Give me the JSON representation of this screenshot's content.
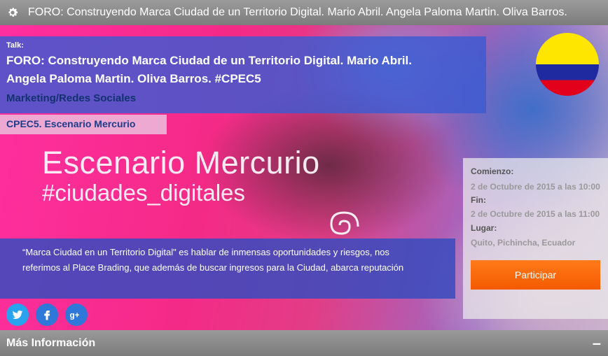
{
  "header": {
    "title": "FORO: Construyendo Marca Ciudad de un Territorio Digital. Mario Abril. Angela Paloma Martin. Oliva Barros.",
    "icon": "gear-icon"
  },
  "talk": {
    "kicker": "Talk:",
    "title": "FORO: Construyendo Marca Ciudad de un Territorio Digital. Mario Abril. Angela Paloma Martin. Oliva Barros. #CPEC5",
    "category": "Marketing/Redes Sociales"
  },
  "stage": {
    "tag": "CPEC5. Escenario Mercurio",
    "banner_title": "Escenario Mercurio",
    "banner_hashtag": "#ciudades_digitales"
  },
  "schedule": {
    "start_label": "Comienzo:",
    "start_value": "2 de Octubre de 2015 a las 10:00",
    "end_label": "Fin:",
    "end_value": "2 de Octubre de 2015 a las 11:00",
    "place_label": "Lugar:",
    "place_value": "Quito, Pichincha, Ecuador",
    "cta": "Participar"
  },
  "description": "“Marca Ciudad en un Territorio Digital\" es hablar de inmensas oportunidades y riesgos, nos referimos al Place Brading, que además de buscar ingresos para la Ciudad, abarca reputación",
  "social": {
    "twitter": "twitter-icon",
    "facebook": "facebook-icon",
    "googleplus": "googleplus-icon"
  },
  "more_info": {
    "label": "Más Información",
    "toggle": "–"
  },
  "colors": {
    "accent_orange": "#f45a00",
    "header_gray": "#8a8a8a",
    "panel_blue": "#3c5ad2",
    "flag": [
      "#ffe600",
      "#1f2aa0",
      "#e3001b"
    ]
  }
}
